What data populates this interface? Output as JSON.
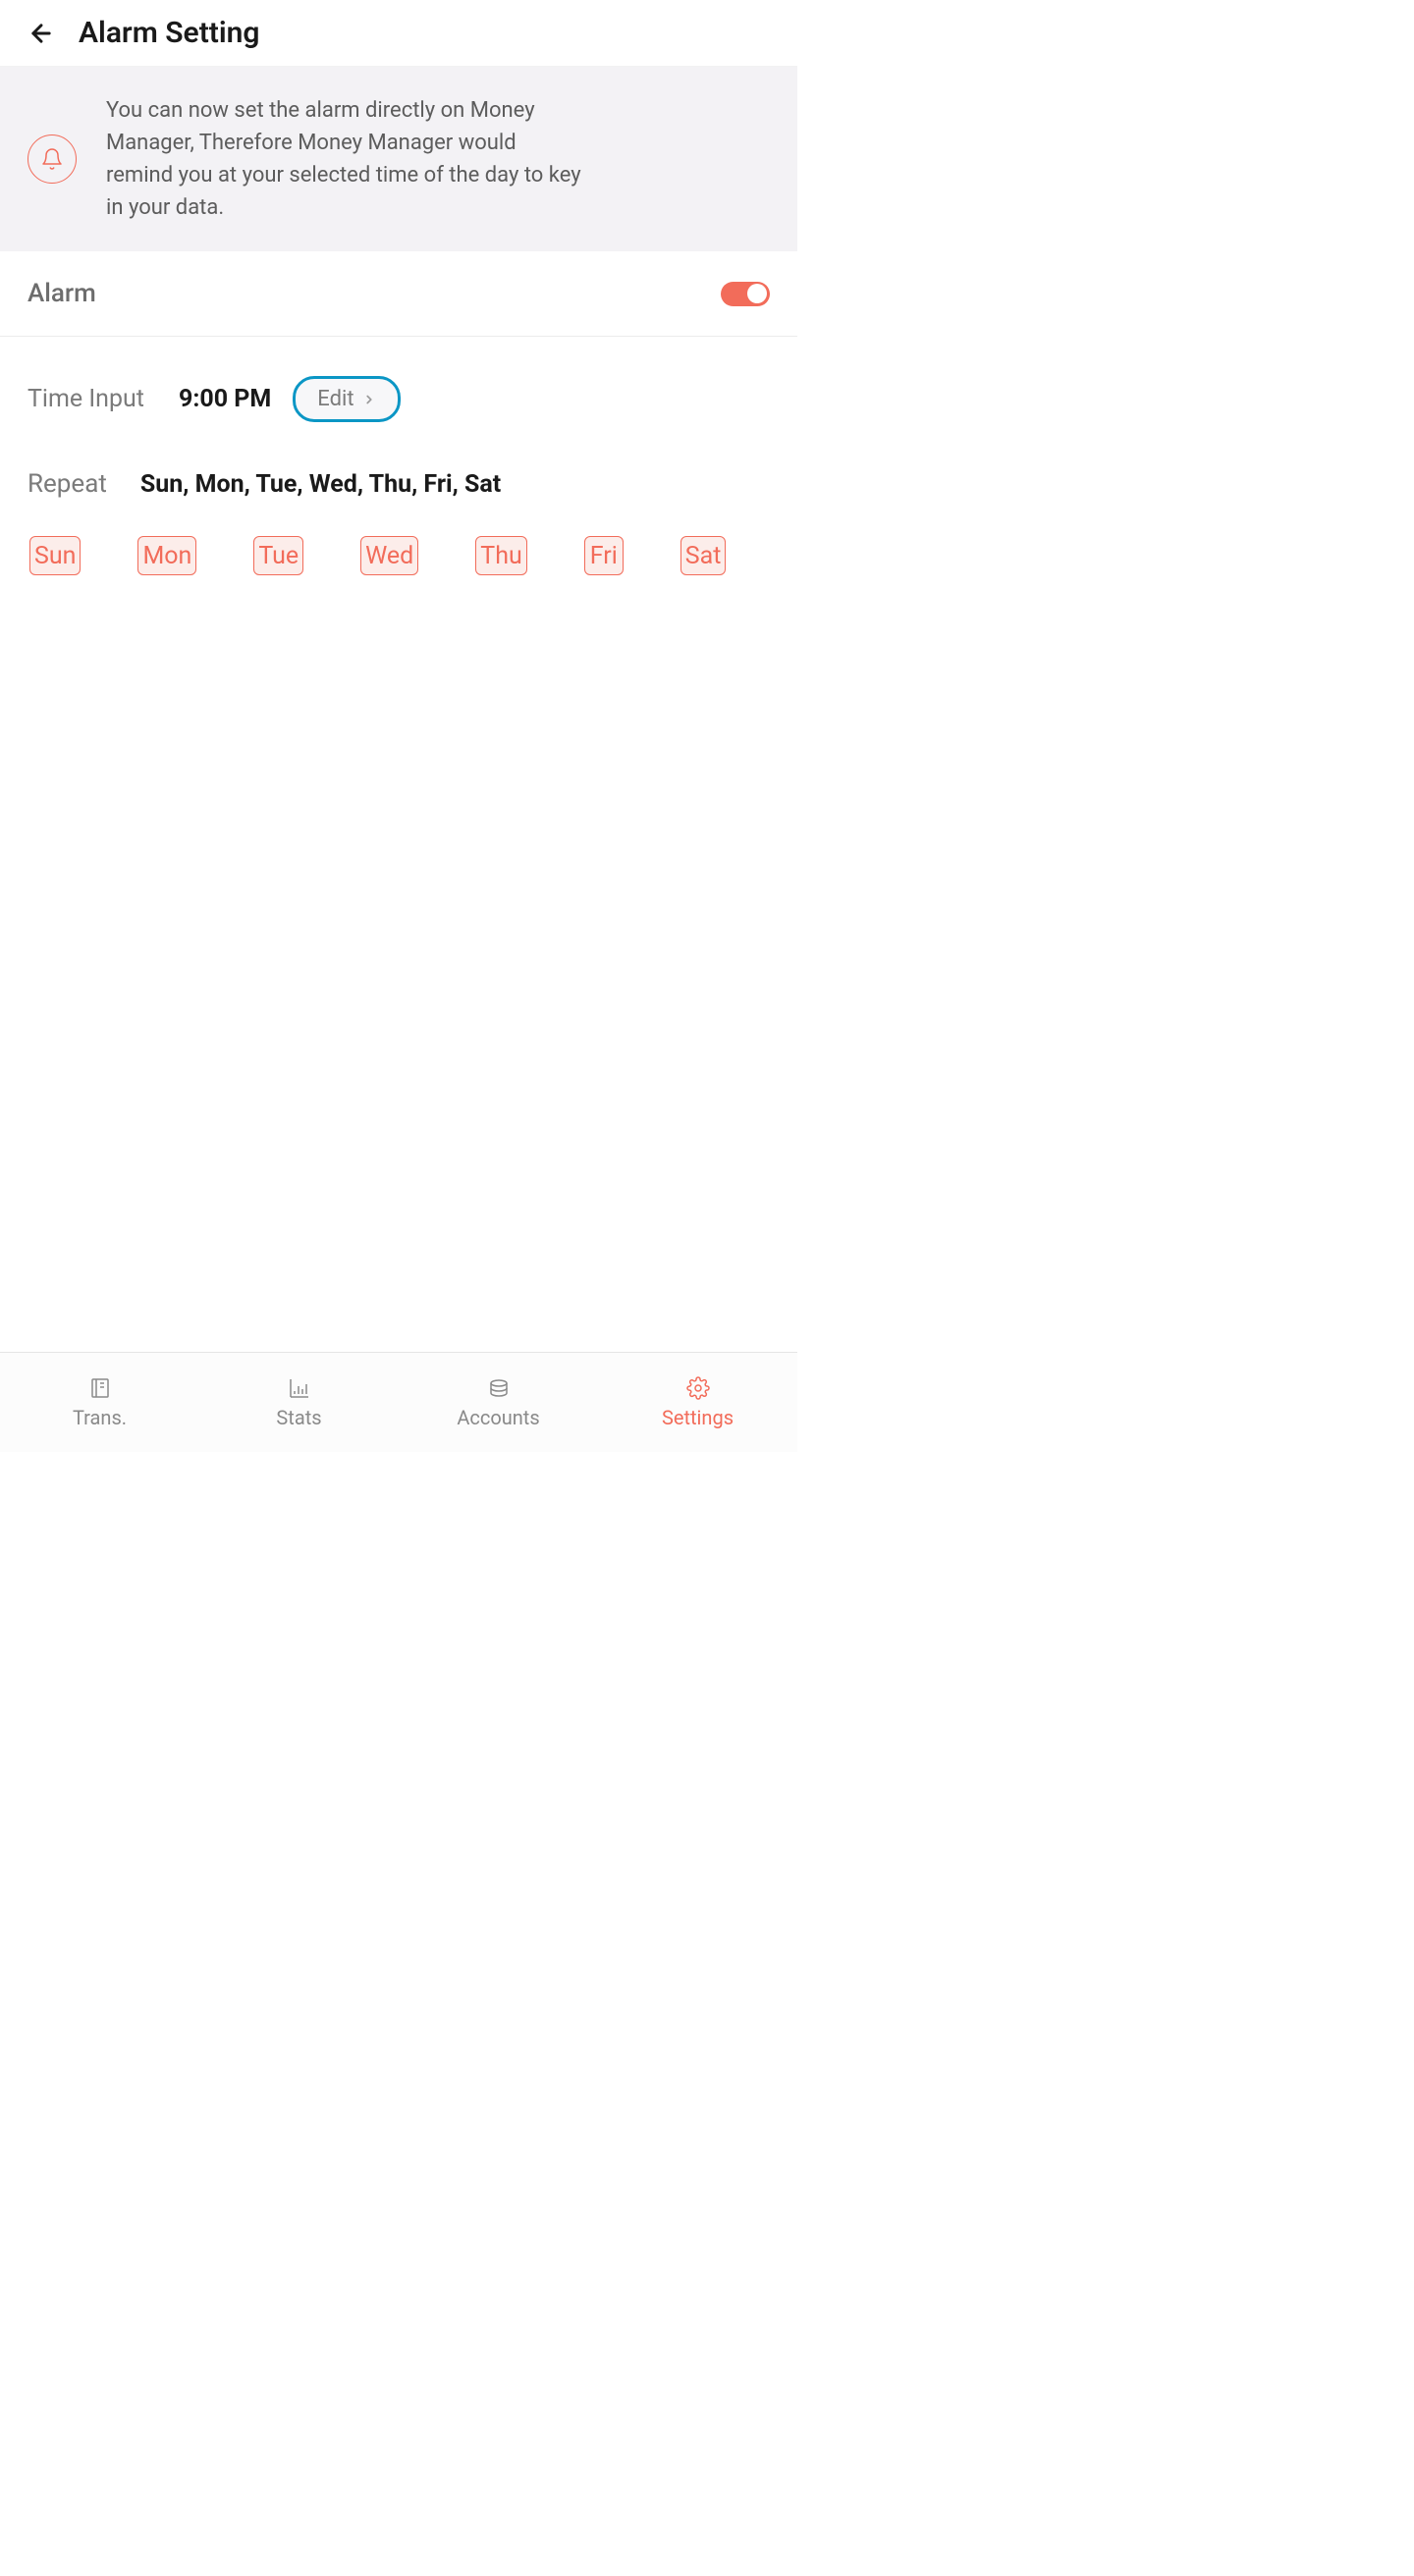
{
  "header": {
    "title": "Alarm Setting"
  },
  "banner": {
    "text": "You can now set the alarm directly on Money Manager, Therefore Money Manager would remind you at your selected time of the day to key in your data."
  },
  "alarm": {
    "label": "Alarm",
    "enabled": true
  },
  "timeInput": {
    "label": "Time Input",
    "value": "9:00 PM",
    "editLabel": "Edit"
  },
  "repeat": {
    "label": "Repeat",
    "value": "Sun, Mon, Tue, Wed, Thu, Fri, Sat",
    "days": [
      "Sun",
      "Mon",
      "Tue",
      "Wed",
      "Thu",
      "Fri",
      "Sat"
    ]
  },
  "nav": {
    "items": [
      {
        "label": "Trans.",
        "icon": "book"
      },
      {
        "label": "Stats",
        "icon": "chart"
      },
      {
        "label": "Accounts",
        "icon": "coins"
      },
      {
        "label": "Settings",
        "icon": "gear"
      }
    ],
    "activeIndex": 3
  }
}
